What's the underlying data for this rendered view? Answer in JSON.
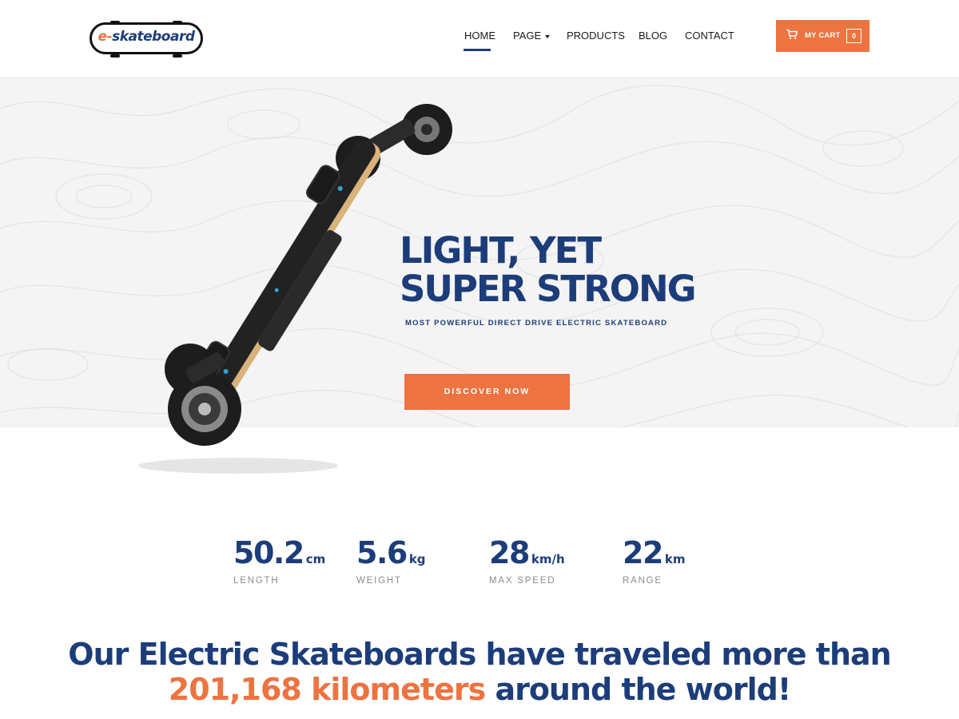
{
  "brand": {
    "logo_e": "e-",
    "logo_rest": "skateboard",
    "accent_color": "#ed7341",
    "primary_color": "#1c3d7a"
  },
  "nav": {
    "items": [
      {
        "label": "HOME",
        "active": true
      },
      {
        "label": "PAGE",
        "has_dropdown": true
      },
      {
        "label": "PRODUCTS"
      },
      {
        "label": "BLOG"
      },
      {
        "label": "CONTACT"
      }
    ]
  },
  "cart": {
    "icon": "cart-icon",
    "label": "MY CART",
    "count": "0"
  },
  "hero": {
    "title_line1": "LIGHT, YET",
    "title_line2": "SUPER STRONG",
    "subtitle": "MOST POWERFUL DIRECT DRIVE ELECTRIC SKATEBOARD",
    "cta_label": "DISCOVER NOW",
    "image": "electric-skateboard-image"
  },
  "stats": [
    {
      "value": "50.2",
      "unit": "cm",
      "label": "LENGTH"
    },
    {
      "value": "5.6",
      "unit": "kg",
      "label": "WEIGHT"
    },
    {
      "value": "28",
      "unit": "km/h",
      "label": "MAX SPEED"
    },
    {
      "value": "22",
      "unit": "km",
      "label": "RANGE"
    }
  ],
  "headline": {
    "part1": "Our Electric Skateboards have traveled more than",
    "highlight": "201,168 kilometers",
    "part2": "around the world!"
  }
}
